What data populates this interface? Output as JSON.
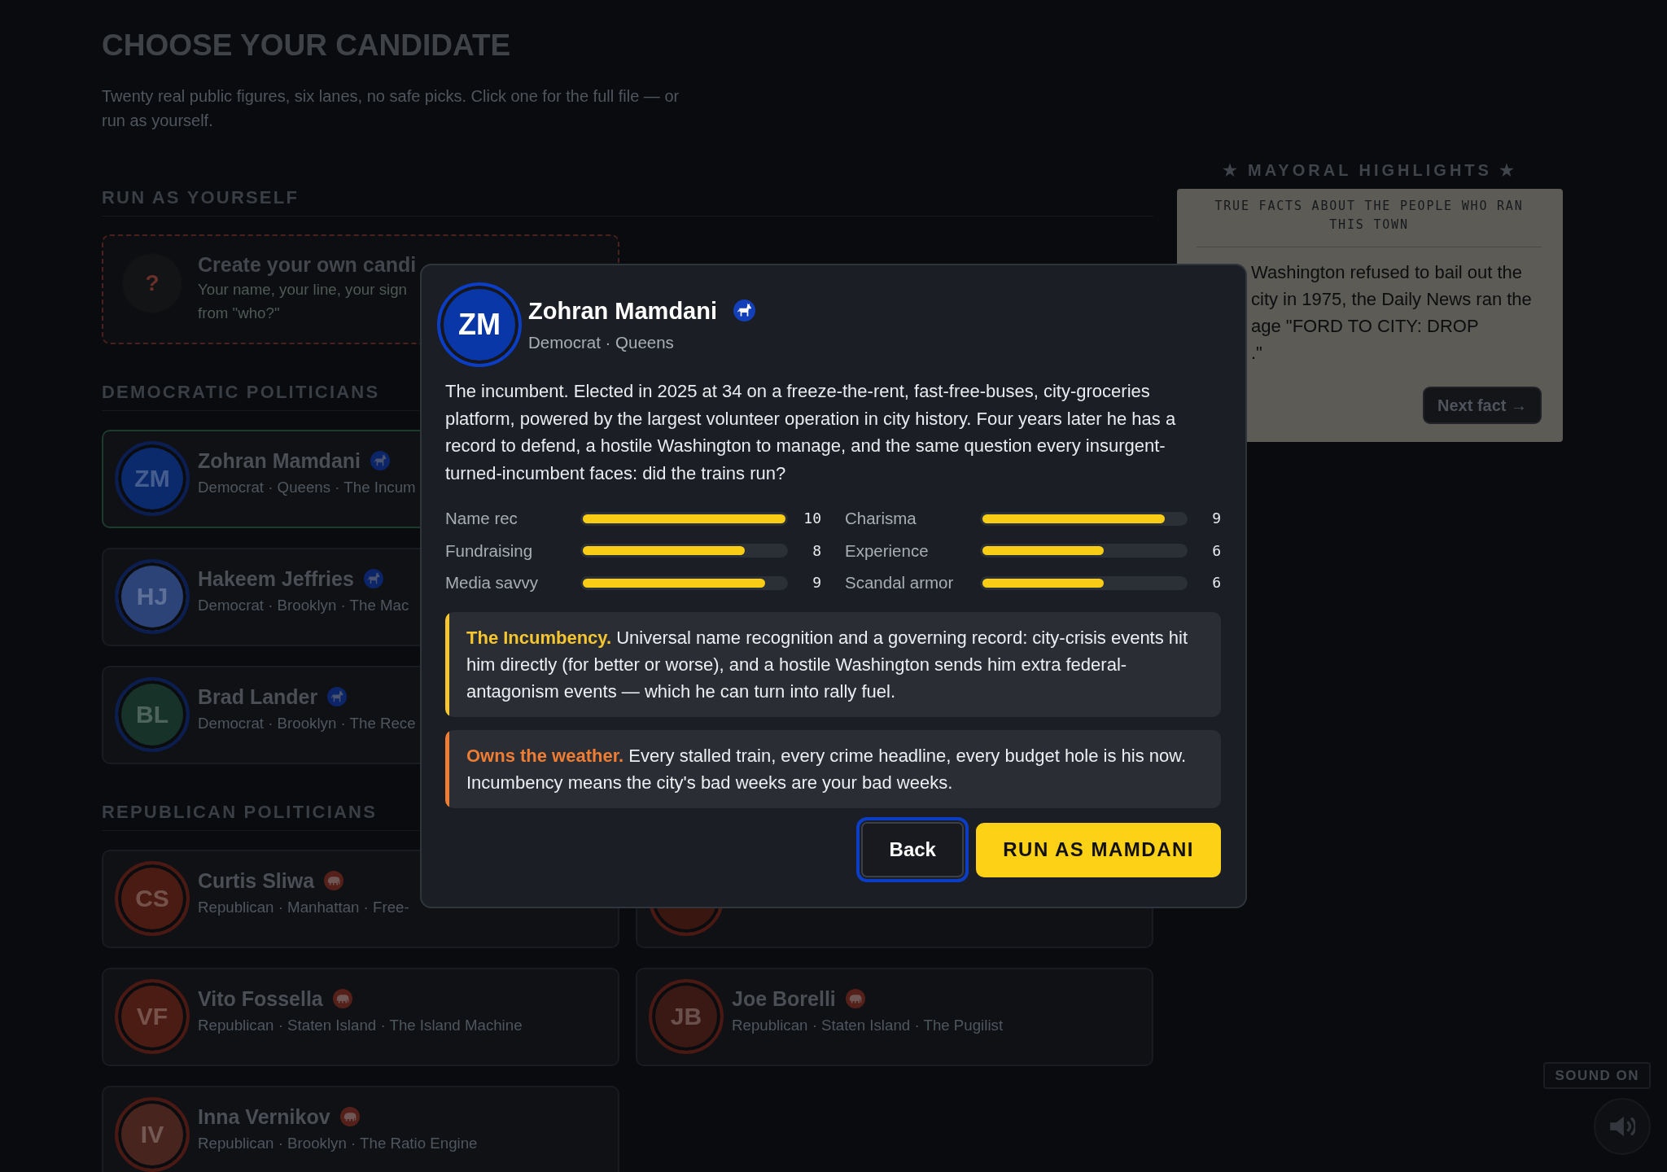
{
  "header": {
    "title": "CHOOSE YOUR CANDIDATE",
    "subtitle": "Twenty real public figures, six lanes, no safe picks. Click one for the full file — or run as yourself."
  },
  "own_candidate": {
    "heading": "RUN AS YOURSELF",
    "avatar": "?",
    "title": "Create your own candi",
    "description_lines": [
      "Your name, your line, your sign",
      "from \"who?\""
    ]
  },
  "sections": [
    {
      "heading": "DEMOCRATIC POLITICIANS",
      "kind": "democrat",
      "rows": [
        [
          {
            "initials": "ZM",
            "name": "Zohran Mamdani",
            "details": "Democrat · Queens · The Incum",
            "color": "#0b2a6b",
            "selected": true
          }
        ],
        [
          {
            "initials": "HJ",
            "name": "Hakeem Jeffries",
            "details": "Democrat · Brooklyn · The Mac",
            "color": "#2c4377",
            "selected": false
          }
        ],
        [
          {
            "initials": "BL",
            "name": "Brad Lander",
            "details": "Democrat · Brooklyn · The Rece",
            "color": "#173229",
            "selected": false
          }
        ]
      ]
    },
    {
      "heading": "REPUBLICAN POLITICIANS",
      "kind": "republican",
      "rows": [
        [
          {
            "initials": "CS",
            "name": "Curtis Sliwa",
            "details": "Republican · Manhattan · Free-",
            "color": "#4a1b13",
            "selected": false
          },
          {
            "color": "#3a1611",
            "selected": false
          }
        ],
        [
          {
            "initials": "VF",
            "name": "Vito Fossella",
            "details": "Republican · Staten Island · The Island Machine",
            "color": "#4b1c13",
            "selected": false
          },
          {
            "initials": "JB",
            "name": "Joe Borelli",
            "details": "Republican · Staten Island · The Pugilist",
            "color": "#3a1914",
            "selected": false
          }
        ],
        [
          {
            "initials": "IV",
            "name": "Inna Vernikov",
            "details": "Republican · Brooklyn · The Ratio Engine",
            "color": "#48241f",
            "selected": false
          }
        ]
      ]
    }
  ],
  "highlights": {
    "heading": "★ MAYORAL HIGHLIGHTS ★",
    "subtitle": "TRUE FACTS ABOUT THE PEOPLE WHO RAN THIS TOWN",
    "fact_lines": [
      "Washington refused to bail out the",
      "city in 1975, the Daily News ran the",
      "age \"FORD TO CITY: DROP",
      ".\""
    ],
    "button": "Next fact →"
  },
  "sound": {
    "status": "SOUND ON"
  },
  "dialog": {
    "initials": "ZM",
    "color": "#0a37a8",
    "kind": "democrat",
    "name": "Zohran Mamdani",
    "details": "Democrat · Queens",
    "bio": "The incumbent. Elected in 2025 at 34 on a freeze-the-rent, fast-free-buses, city-groceries platform, powered by the largest volunteer operation in city history. Four years later he has a record to defend, a hostile Washington to manage, and the same question every insurgent-turned-incumbent faces: did the trains run?",
    "stats": [
      {
        "label": "Name rec",
        "level": 1.0,
        "value": "10"
      },
      {
        "label": "Charisma",
        "level": 0.9,
        "value": "9"
      },
      {
        "label": "Fundraising",
        "level": 0.8,
        "value": "8"
      },
      {
        "label": "Experience",
        "level": 0.6,
        "value": "6"
      },
      {
        "label": "Media savvy",
        "level": 0.9,
        "value": "9"
      },
      {
        "label": "Scandal armor",
        "level": 0.6,
        "value": "6"
      }
    ],
    "callouts": [
      {
        "text": "**The Incumbency.** Universal name recognition and a governing record: city-crisis events hit him directly (for better or worse), and a hostile Washington sends him extra federal-antagonism events — which he can turn into rally fuel.",
        "color": "#f6c630"
      },
      {
        "text": "**Owns the weather.** Every stalled train, every crime headline, every budget hole is his now. Incumbency means the city's bad weeks are your bad weeks.",
        "color": "#ef7d34"
      }
    ],
    "buttons": [
      {
        "label": "Back",
        "kind": "secondary",
        "focused": true
      },
      {
        "label": "RUN AS MAMDANI",
        "kind": "primary",
        "focused": false
      }
    ]
  }
}
